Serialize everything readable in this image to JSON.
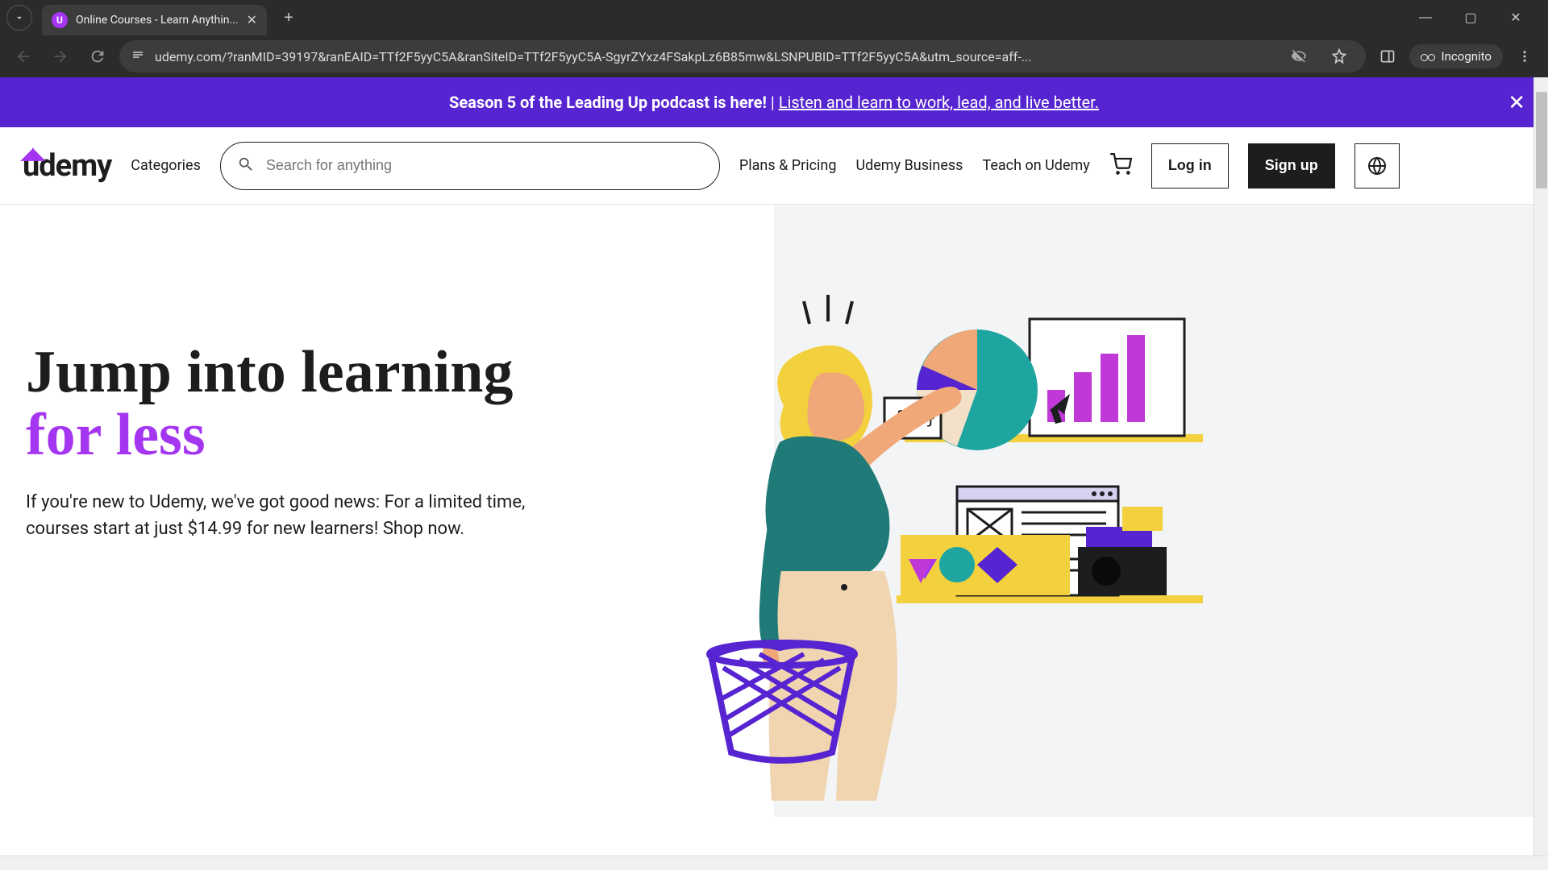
{
  "browser": {
    "tab_title": "Online Courses - Learn Anythin...",
    "url": "udemy.com/?ranMID=39197&ranEAID=TTf2F5yyC5A&ranSiteID=TTf2F5yyC5A-SgyrZYxz4FSakpLz6B85mw&LSNPUBID=TTf2F5yyC5A&utm_source=aff-...",
    "incognito_label": "Incognito"
  },
  "promo": {
    "bold_text": "Season 5 of the Leading Up podcast is here!",
    "separator": " | ",
    "link_text": "Listen and learn to work, lead, and live better."
  },
  "header": {
    "logo_text": "ûdemy",
    "categories": "Categories",
    "search_placeholder": "Search for anything",
    "plans": "Plans & Pricing",
    "business": "Udemy Business",
    "teach": "Teach on Udemy",
    "login": "Log in",
    "signup": "Sign up"
  },
  "hero": {
    "title_line1": "Jump into learning",
    "title_line2": "for less",
    "subtitle": "If you're new to Udemy, we've got good news: For a limited time, courses start at just $14.99 for new learners! Shop now."
  },
  "colors": {
    "brand_purple": "#5624d0",
    "accent_purple": "#a435f0",
    "text_dark": "#1c1d1f",
    "teal": "#1fa5a0",
    "yellow": "#f3d03e",
    "skin": "#f0a878",
    "magenta": "#c039d8"
  }
}
